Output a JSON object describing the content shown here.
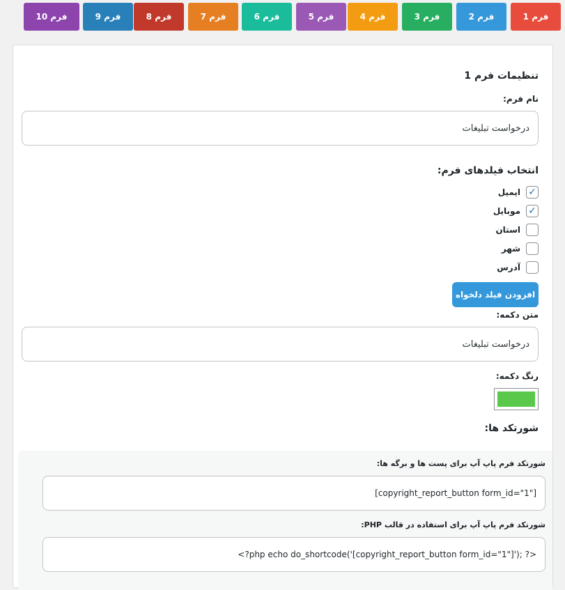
{
  "tabs": [
    {
      "label": "فرم 1",
      "color": "#e74c3c"
    },
    {
      "label": "فرم 2",
      "color": "#3498db"
    },
    {
      "label": "فرم 3",
      "color": "#27ae60"
    },
    {
      "label": "فرم 4",
      "color": "#f39c12"
    },
    {
      "label": "فرم 5",
      "color": "#9b59b6"
    },
    {
      "label": "فرم 6",
      "color": "#1abc9c"
    },
    {
      "label": "فرم 7",
      "color": "#e67e22"
    },
    {
      "label": "فرم 8",
      "color": "#c0392b"
    },
    {
      "label": "فرم 9",
      "color": "#2980b9"
    },
    {
      "label": "فرم 10",
      "color": "#8e44ad"
    }
  ],
  "settings": {
    "title": "تنظیمات فرم 1",
    "form_name_label": "نام فرم:",
    "form_name_value": "درخواست تبلیغات",
    "fields_title": "انتخاب فیلدهای فرم:",
    "fields": [
      {
        "label": "ایمیل",
        "checked": true
      },
      {
        "label": "موبایل",
        "checked": true
      },
      {
        "label": "استان",
        "checked": false
      },
      {
        "label": "شهر",
        "checked": false
      },
      {
        "label": "آدرس",
        "checked": false
      }
    ],
    "add_field_button": "افزودن فیلد دلخواه",
    "button_text_label": "متن دکمه:",
    "button_text_value": "درخواست تبلیغات",
    "button_color_label": "رنگ دکمه:",
    "button_color": "#5ac94b"
  },
  "shortcodes": {
    "title": "شورتکد ها:",
    "post_label": "شورتکد فرم پاپ آپ برای پست ها و برگه ها:",
    "post_value": "[copyright_report_button form_id=\"1\"]",
    "php_label": "شورتکد فرم پاپ آپ برای استفاده در قالب PHP:",
    "php_value": "<?php echo do_shortcode('[copyright_report_button form_id=\"1\"]'); ?>"
  }
}
